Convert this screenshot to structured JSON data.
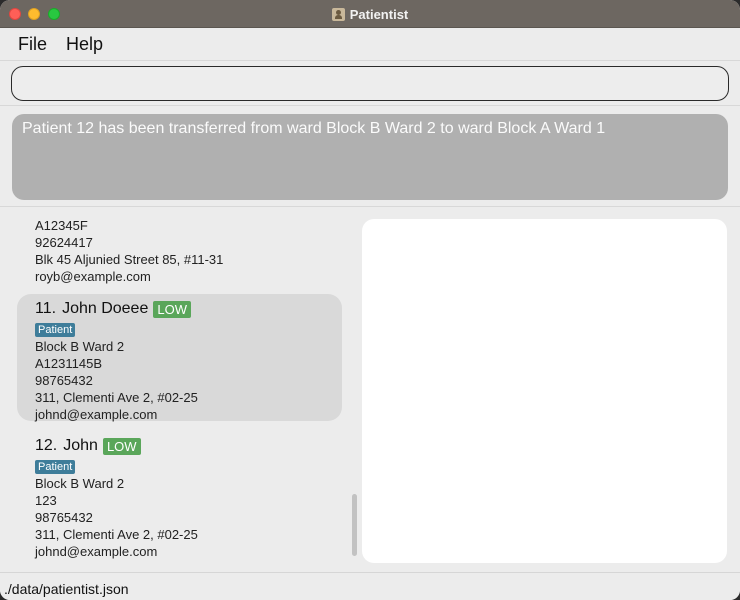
{
  "window": {
    "title": "Patientist",
    "app_icon": "person-icon"
  },
  "menu": {
    "file": "File",
    "help": "Help"
  },
  "command": {
    "value": "",
    "placeholder": ""
  },
  "result": {
    "message": "Patient 12 has been transferred from ward Block B Ward 2 to ward Block A Ward 1"
  },
  "persons": [
    {
      "id": "A12345F",
      "phone": "92624417",
      "address": "Blk 45 Aljunied Street 85, #11-31",
      "email": "royb@example.com"
    },
    {
      "index": "11.",
      "name": "John Doeee",
      "priority": "LOW",
      "tag": "Patient",
      "ward": "Block B Ward 2",
      "id": "A1231145B",
      "phone": "98765432",
      "address": "311, Clementi Ave 2, #02-25",
      "email": "johnd@example.com"
    },
    {
      "index": "12.",
      "name": "John",
      "priority": "LOW",
      "tag": "Patient",
      "ward": "Block B Ward 2",
      "id": "123",
      "phone": "98765432",
      "address": "311, Clementi Ave 2, #02-25",
      "email": "johnd@example.com"
    }
  ],
  "status": {
    "file_path": "./data/patientist.json"
  },
  "colors": {
    "priority_low": "#5aa65a",
    "tag_patient": "#3e7d9a",
    "result_background": "#b0b0b0",
    "selected_card": "#d9d9d9"
  }
}
